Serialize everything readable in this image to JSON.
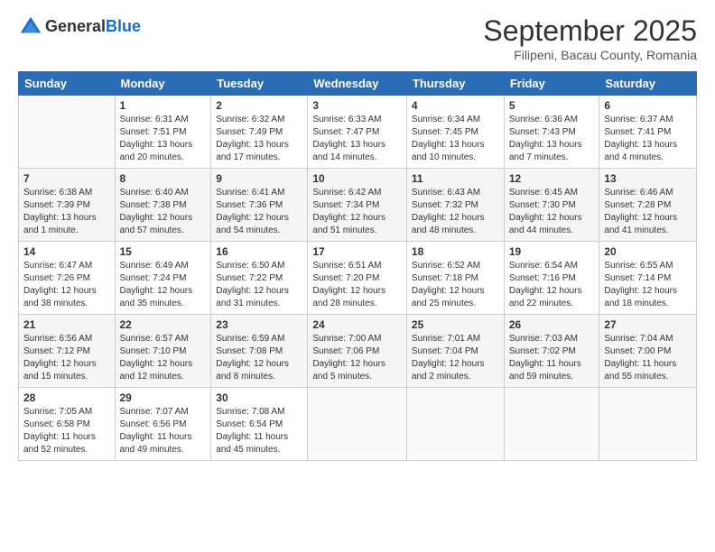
{
  "header": {
    "logo_line1": "General",
    "logo_line2": "Blue",
    "month": "September 2025",
    "location": "Filipeni, Bacau County, Romania"
  },
  "days_of_week": [
    "Sunday",
    "Monday",
    "Tuesday",
    "Wednesday",
    "Thursday",
    "Friday",
    "Saturday"
  ],
  "weeks": [
    [
      {
        "day": "",
        "sunrise": "",
        "sunset": "",
        "daylight": ""
      },
      {
        "day": "1",
        "sunrise": "Sunrise: 6:31 AM",
        "sunset": "Sunset: 7:51 PM",
        "daylight": "Daylight: 13 hours and 20 minutes."
      },
      {
        "day": "2",
        "sunrise": "Sunrise: 6:32 AM",
        "sunset": "Sunset: 7:49 PM",
        "daylight": "Daylight: 13 hours and 17 minutes."
      },
      {
        "day": "3",
        "sunrise": "Sunrise: 6:33 AM",
        "sunset": "Sunset: 7:47 PM",
        "daylight": "Daylight: 13 hours and 14 minutes."
      },
      {
        "day": "4",
        "sunrise": "Sunrise: 6:34 AM",
        "sunset": "Sunset: 7:45 PM",
        "daylight": "Daylight: 13 hours and 10 minutes."
      },
      {
        "day": "5",
        "sunrise": "Sunrise: 6:36 AM",
        "sunset": "Sunset: 7:43 PM",
        "daylight": "Daylight: 13 hours and 7 minutes."
      },
      {
        "day": "6",
        "sunrise": "Sunrise: 6:37 AM",
        "sunset": "Sunset: 7:41 PM",
        "daylight": "Daylight: 13 hours and 4 minutes."
      }
    ],
    [
      {
        "day": "7",
        "sunrise": "Sunrise: 6:38 AM",
        "sunset": "Sunset: 7:39 PM",
        "daylight": "Daylight: 13 hours and 1 minute."
      },
      {
        "day": "8",
        "sunrise": "Sunrise: 6:40 AM",
        "sunset": "Sunset: 7:38 PM",
        "daylight": "Daylight: 12 hours and 57 minutes."
      },
      {
        "day": "9",
        "sunrise": "Sunrise: 6:41 AM",
        "sunset": "Sunset: 7:36 PM",
        "daylight": "Daylight: 12 hours and 54 minutes."
      },
      {
        "day": "10",
        "sunrise": "Sunrise: 6:42 AM",
        "sunset": "Sunset: 7:34 PM",
        "daylight": "Daylight: 12 hours and 51 minutes."
      },
      {
        "day": "11",
        "sunrise": "Sunrise: 6:43 AM",
        "sunset": "Sunset: 7:32 PM",
        "daylight": "Daylight: 12 hours and 48 minutes."
      },
      {
        "day": "12",
        "sunrise": "Sunrise: 6:45 AM",
        "sunset": "Sunset: 7:30 PM",
        "daylight": "Daylight: 12 hours and 44 minutes."
      },
      {
        "day": "13",
        "sunrise": "Sunrise: 6:46 AM",
        "sunset": "Sunset: 7:28 PM",
        "daylight": "Daylight: 12 hours and 41 minutes."
      }
    ],
    [
      {
        "day": "14",
        "sunrise": "Sunrise: 6:47 AM",
        "sunset": "Sunset: 7:26 PM",
        "daylight": "Daylight: 12 hours and 38 minutes."
      },
      {
        "day": "15",
        "sunrise": "Sunrise: 6:49 AM",
        "sunset": "Sunset: 7:24 PM",
        "daylight": "Daylight: 12 hours and 35 minutes."
      },
      {
        "day": "16",
        "sunrise": "Sunrise: 6:50 AM",
        "sunset": "Sunset: 7:22 PM",
        "daylight": "Daylight: 12 hours and 31 minutes."
      },
      {
        "day": "17",
        "sunrise": "Sunrise: 6:51 AM",
        "sunset": "Sunset: 7:20 PM",
        "daylight": "Daylight: 12 hours and 28 minutes."
      },
      {
        "day": "18",
        "sunrise": "Sunrise: 6:52 AM",
        "sunset": "Sunset: 7:18 PM",
        "daylight": "Daylight: 12 hours and 25 minutes."
      },
      {
        "day": "19",
        "sunrise": "Sunrise: 6:54 AM",
        "sunset": "Sunset: 7:16 PM",
        "daylight": "Daylight: 12 hours and 22 minutes."
      },
      {
        "day": "20",
        "sunrise": "Sunrise: 6:55 AM",
        "sunset": "Sunset: 7:14 PM",
        "daylight": "Daylight: 12 hours and 18 minutes."
      }
    ],
    [
      {
        "day": "21",
        "sunrise": "Sunrise: 6:56 AM",
        "sunset": "Sunset: 7:12 PM",
        "daylight": "Daylight: 12 hours and 15 minutes."
      },
      {
        "day": "22",
        "sunrise": "Sunrise: 6:57 AM",
        "sunset": "Sunset: 7:10 PM",
        "daylight": "Daylight: 12 hours and 12 minutes."
      },
      {
        "day": "23",
        "sunrise": "Sunrise: 6:59 AM",
        "sunset": "Sunset: 7:08 PM",
        "daylight": "Daylight: 12 hours and 8 minutes."
      },
      {
        "day": "24",
        "sunrise": "Sunrise: 7:00 AM",
        "sunset": "Sunset: 7:06 PM",
        "daylight": "Daylight: 12 hours and 5 minutes."
      },
      {
        "day": "25",
        "sunrise": "Sunrise: 7:01 AM",
        "sunset": "Sunset: 7:04 PM",
        "daylight": "Daylight: 12 hours and 2 minutes."
      },
      {
        "day": "26",
        "sunrise": "Sunrise: 7:03 AM",
        "sunset": "Sunset: 7:02 PM",
        "daylight": "Daylight: 11 hours and 59 minutes."
      },
      {
        "day": "27",
        "sunrise": "Sunrise: 7:04 AM",
        "sunset": "Sunset: 7:00 PM",
        "daylight": "Daylight: 11 hours and 55 minutes."
      }
    ],
    [
      {
        "day": "28",
        "sunrise": "Sunrise: 7:05 AM",
        "sunset": "Sunset: 6:58 PM",
        "daylight": "Daylight: 11 hours and 52 minutes."
      },
      {
        "day": "29",
        "sunrise": "Sunrise: 7:07 AM",
        "sunset": "Sunset: 6:56 PM",
        "daylight": "Daylight: 11 hours and 49 minutes."
      },
      {
        "day": "30",
        "sunrise": "Sunrise: 7:08 AM",
        "sunset": "Sunset: 6:54 PM",
        "daylight": "Daylight: 11 hours and 45 minutes."
      },
      {
        "day": "",
        "sunrise": "",
        "sunset": "",
        "daylight": ""
      },
      {
        "day": "",
        "sunrise": "",
        "sunset": "",
        "daylight": ""
      },
      {
        "day": "",
        "sunrise": "",
        "sunset": "",
        "daylight": ""
      },
      {
        "day": "",
        "sunrise": "",
        "sunset": "",
        "daylight": ""
      }
    ]
  ]
}
